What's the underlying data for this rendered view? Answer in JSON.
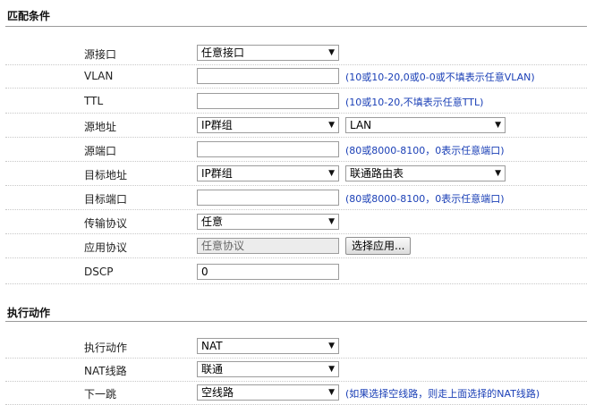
{
  "match_section": {
    "title": "匹配条件",
    "rows": {
      "src_interface": {
        "label": "源接口",
        "value": "任意接口"
      },
      "vlan": {
        "label": "VLAN",
        "value": "",
        "hint": "(10或10-20,0或0-0或不填表示任意VLAN)"
      },
      "ttl": {
        "label": "TTL",
        "value": "",
        "hint": "(10或10-20,不填表示任意TTL)"
      },
      "src_addr": {
        "label": "源地址",
        "type_value": "IP群组",
        "group_value": "LAN"
      },
      "src_port": {
        "label": "源端口",
        "value": "",
        "hint": "(80或8000-8100，0表示任意端口)"
      },
      "dst_addr": {
        "label": "目标地址",
        "type_value": "IP群组",
        "group_value": "联通路由表"
      },
      "dst_port": {
        "label": "目标端口",
        "value": "",
        "hint": "(80或8000-8100，0表示任意端口)"
      },
      "protocol": {
        "label": "传输协议",
        "value": "任意"
      },
      "app_protocol": {
        "label": "应用协议",
        "value": "任意协议",
        "button_label": "选择应用..."
      },
      "dscp": {
        "label": "DSCP",
        "value": "0"
      }
    }
  },
  "action_section": {
    "title": "执行动作",
    "rows": {
      "action": {
        "label": "执行动作",
        "value": "NAT"
      },
      "nat_line": {
        "label": "NAT线路",
        "value": "联通"
      },
      "next_hop": {
        "label": "下一跳",
        "value": "空线路",
        "hint": "(如果选择空线路，则走上面选择的NAT线路)"
      }
    }
  },
  "icons": {
    "dropdown_arrow": "▼"
  }
}
